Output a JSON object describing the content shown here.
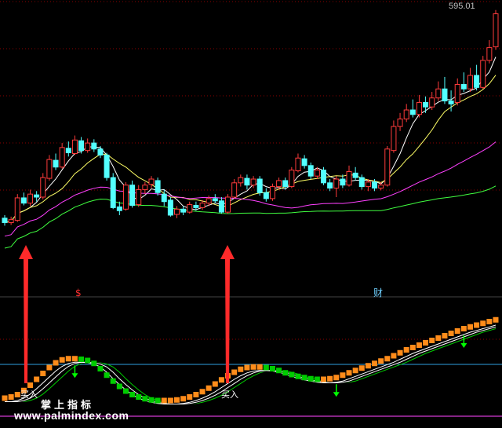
{
  "header": {
    "price_label": "595.01"
  },
  "signals": {
    "top_mark": "$",
    "wealth_mark": "财",
    "buy_1": "买入",
    "buy_2": "买入"
  },
  "watermark": {
    "cn": "掌上指标",
    "site": "www.palmindex.com"
  },
  "colors": {
    "bull": "#ff3b3b",
    "bear": "#53ffff",
    "ma_fast": "#ffffff",
    "ma_mid": "#ffff66",
    "ma_slow": "#ff40ff",
    "ma_long": "#40ff40",
    "orange": "#ff8c1a",
    "green": "#00cc00",
    "arrow": "#ff2a2a",
    "down_arrow": "#00ff00",
    "grid": "#8b0000",
    "blue_line": "#2e9fe0",
    "magenta_line": "#b030b0"
  },
  "chart_data": [
    {
      "type": "candlestick",
      "y_max_label": "595.01",
      "candles": [
        {
          "o": 318,
          "c": 312,
          "h": 322,
          "l": 308
        },
        {
          "o": 312,
          "c": 316,
          "h": 320,
          "l": 309
        },
        {
          "o": 315,
          "c": 345,
          "h": 350,
          "l": 313
        },
        {
          "o": 345,
          "c": 338,
          "h": 352,
          "l": 335
        },
        {
          "o": 338,
          "c": 350,
          "h": 356,
          "l": 334
        },
        {
          "o": 349,
          "c": 346,
          "h": 354,
          "l": 340
        },
        {
          "o": 346,
          "c": 372,
          "h": 378,
          "l": 343
        },
        {
          "o": 371,
          "c": 396,
          "h": 402,
          "l": 368
        },
        {
          "o": 395,
          "c": 386,
          "h": 404,
          "l": 382
        },
        {
          "o": 386,
          "c": 412,
          "h": 418,
          "l": 384
        },
        {
          "o": 411,
          "c": 405,
          "h": 420,
          "l": 400
        },
        {
          "o": 404,
          "c": 422,
          "h": 428,
          "l": 402
        },
        {
          "o": 421,
          "c": 408,
          "h": 426,
          "l": 404
        },
        {
          "o": 408,
          "c": 418,
          "h": 424,
          "l": 405
        },
        {
          "o": 418,
          "c": 410,
          "h": 423,
          "l": 406
        },
        {
          "o": 410,
          "c": 402,
          "h": 414,
          "l": 398
        },
        {
          "o": 402,
          "c": 372,
          "h": 405,
          "l": 368
        },
        {
          "o": 372,
          "c": 332,
          "h": 378,
          "l": 330
        },
        {
          "o": 333,
          "c": 328,
          "h": 340,
          "l": 322
        },
        {
          "o": 330,
          "c": 362,
          "h": 366,
          "l": 328
        },
        {
          "o": 362,
          "c": 335,
          "h": 368,
          "l": 332
        },
        {
          "o": 336,
          "c": 356,
          "h": 362,
          "l": 333
        },
        {
          "o": 356,
          "c": 362,
          "h": 366,
          "l": 350
        },
        {
          "o": 363,
          "c": 370,
          "h": 374,
          "l": 358
        },
        {
          "o": 368,
          "c": 352,
          "h": 372,
          "l": 348
        },
        {
          "o": 350,
          "c": 340,
          "h": 356,
          "l": 334
        },
        {
          "o": 342,
          "c": 322,
          "h": 346,
          "l": 320
        },
        {
          "o": 323,
          "c": 330,
          "h": 334,
          "l": 318
        },
        {
          "o": 330,
          "c": 326,
          "h": 334,
          "l": 322
        },
        {
          "o": 326,
          "c": 336,
          "h": 340,
          "l": 324
        },
        {
          "o": 335,
          "c": 332,
          "h": 340,
          "l": 328
        },
        {
          "o": 332,
          "c": 338,
          "h": 342,
          "l": 329
        },
        {
          "o": 338,
          "c": 344,
          "h": 348,
          "l": 334
        },
        {
          "o": 344,
          "c": 341,
          "h": 350,
          "l": 338
        },
        {
          "o": 341,
          "c": 326,
          "h": 346,
          "l": 324
        },
        {
          "o": 326,
          "c": 346,
          "h": 350,
          "l": 324
        },
        {
          "o": 346,
          "c": 365,
          "h": 370,
          "l": 344
        },
        {
          "o": 365,
          "c": 372,
          "h": 376,
          "l": 360
        },
        {
          "o": 371,
          "c": 362,
          "h": 376,
          "l": 356
        },
        {
          "o": 362,
          "c": 370,
          "h": 374,
          "l": 358
        },
        {
          "o": 370,
          "c": 352,
          "h": 374,
          "l": 348
        },
        {
          "o": 352,
          "c": 344,
          "h": 358,
          "l": 340
        },
        {
          "o": 344,
          "c": 360,
          "h": 364,
          "l": 341
        },
        {
          "o": 360,
          "c": 368,
          "h": 372,
          "l": 356
        },
        {
          "o": 368,
          "c": 360,
          "h": 372,
          "l": 356
        },
        {
          "o": 360,
          "c": 382,
          "h": 386,
          "l": 358
        },
        {
          "o": 381,
          "c": 398,
          "h": 404,
          "l": 379
        },
        {
          "o": 397,
          "c": 388,
          "h": 402,
          "l": 384
        },
        {
          "o": 388,
          "c": 374,
          "h": 392,
          "l": 370
        },
        {
          "o": 374,
          "c": 382,
          "h": 386,
          "l": 370
        },
        {
          "o": 382,
          "c": 365,
          "h": 386,
          "l": 362
        },
        {
          "o": 365,
          "c": 358,
          "h": 370,
          "l": 354
        },
        {
          "o": 358,
          "c": 370,
          "h": 374,
          "l": 346
        },
        {
          "o": 370,
          "c": 362,
          "h": 376,
          "l": 358
        },
        {
          "o": 362,
          "c": 380,
          "h": 388,
          "l": 360
        },
        {
          "o": 378,
          "c": 372,
          "h": 386,
          "l": 368
        },
        {
          "o": 372,
          "c": 360,
          "h": 376,
          "l": 356
        },
        {
          "o": 360,
          "c": 366,
          "h": 370,
          "l": 354
        },
        {
          "o": 366,
          "c": 358,
          "h": 370,
          "l": 354
        },
        {
          "o": 358,
          "c": 362,
          "h": 366,
          "l": 355
        },
        {
          "o": 362,
          "c": 410,
          "h": 414,
          "l": 360
        },
        {
          "o": 408,
          "c": 440,
          "h": 448,
          "l": 405
        },
        {
          "o": 440,
          "c": 450,
          "h": 458,
          "l": 434
        },
        {
          "o": 450,
          "c": 462,
          "h": 470,
          "l": 446
        },
        {
          "o": 462,
          "c": 456,
          "h": 476,
          "l": 452
        },
        {
          "o": 456,
          "c": 472,
          "h": 482,
          "l": 452
        },
        {
          "o": 472,
          "c": 466,
          "h": 480,
          "l": 458
        },
        {
          "o": 466,
          "c": 478,
          "h": 486,
          "l": 462
        },
        {
          "o": 478,
          "c": 490,
          "h": 500,
          "l": 474
        },
        {
          "o": 490,
          "c": 474,
          "h": 506,
          "l": 470
        },
        {
          "o": 474,
          "c": 470,
          "h": 488,
          "l": 460
        },
        {
          "o": 472,
          "c": 496,
          "h": 504,
          "l": 468
        },
        {
          "o": 496,
          "c": 490,
          "h": 512,
          "l": 486
        },
        {
          "o": 490,
          "c": 508,
          "h": 518,
          "l": 486
        },
        {
          "o": 508,
          "c": 492,
          "h": 522,
          "l": 488
        },
        {
          "o": 492,
          "c": 528,
          "h": 534,
          "l": 490
        },
        {
          "o": 528,
          "c": 545,
          "h": 555,
          "l": 524
        },
        {
          "o": 546,
          "c": 590,
          "h": 595,
          "l": 542
        }
      ],
      "ma_periods": [
        5,
        10,
        30,
        60
      ]
    },
    {
      "type": "oscillator",
      "buy_signals": [
        4,
        40
      ],
      "bottom_signals": [
        3,
        39
      ],
      "top_signals": [
        15,
        55
      ],
      "wealth_signal_at": 70,
      "down_arrows_at": [
        11,
        52,
        72
      ],
      "values": [
        14,
        16,
        20,
        27,
        36,
        46,
        56,
        66,
        74,
        79,
        81,
        81,
        80,
        78,
        73,
        64,
        53,
        43,
        34,
        26,
        20,
        16,
        13,
        11,
        10,
        10,
        10,
        11,
        13,
        16,
        20,
        25,
        31,
        38,
        45,
        52,
        58,
        63,
        66,
        67,
        67,
        66,
        64,
        61,
        57,
        54,
        51,
        49,
        47,
        46,
        46,
        47,
        49,
        53,
        57,
        61,
        65,
        69,
        73,
        77,
        81,
        86,
        91,
        96,
        100,
        104,
        108,
        112,
        116,
        120,
        124,
        128,
        132,
        135,
        138,
        141,
        144,
        147
      ]
    }
  ]
}
